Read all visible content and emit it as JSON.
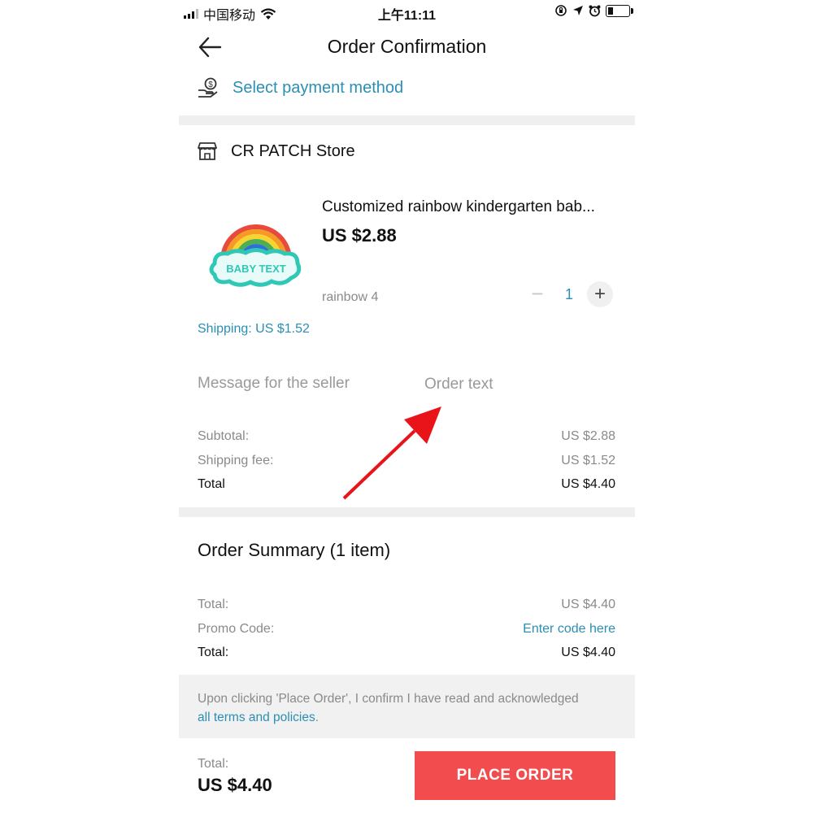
{
  "status_bar": {
    "carrier": "中国移动",
    "time": "上午11:11"
  },
  "header": {
    "title": "Order Confirmation"
  },
  "payment": {
    "label": "Select payment method"
  },
  "store": {
    "name": "CR PATCH Store"
  },
  "product": {
    "image_text": "BABY TEXT",
    "title": "Customized rainbow kindergarten bab...",
    "price": "US $2.88",
    "variant": "rainbow 4",
    "quantity": "1",
    "shipping": "Shipping: US $1.52"
  },
  "seller_message": {
    "label": "Message for the seller",
    "placeholder": "Order text"
  },
  "store_totals": {
    "subtotal_label": "Subtotal:",
    "subtotal_value": "US $2.88",
    "shipping_label": "Shipping fee:",
    "shipping_value": "US $1.52",
    "total_label": "Total",
    "total_value": "US $4.40"
  },
  "order_summary": {
    "title": "Order Summary (1 item)",
    "total_label": "Total:",
    "total_value": "US $4.40",
    "promo_label": "Promo Code:",
    "promo_link": "Enter code here",
    "grand_total_label": "Total:",
    "grand_total_value": "US $4.40"
  },
  "terms": {
    "text": "Upon clicking 'Place Order', I confirm I have read and acknowledged",
    "link": "all terms and policies",
    "suffix": "."
  },
  "footer": {
    "total_label": "Total:",
    "total_amount": "US $4.40",
    "place_order": "PLACE ORDER"
  },
  "colors": {
    "accent_teal": "#2b8fb3",
    "place_order_red": "#f34c4f",
    "annotation_arrow": "#e8141a"
  }
}
